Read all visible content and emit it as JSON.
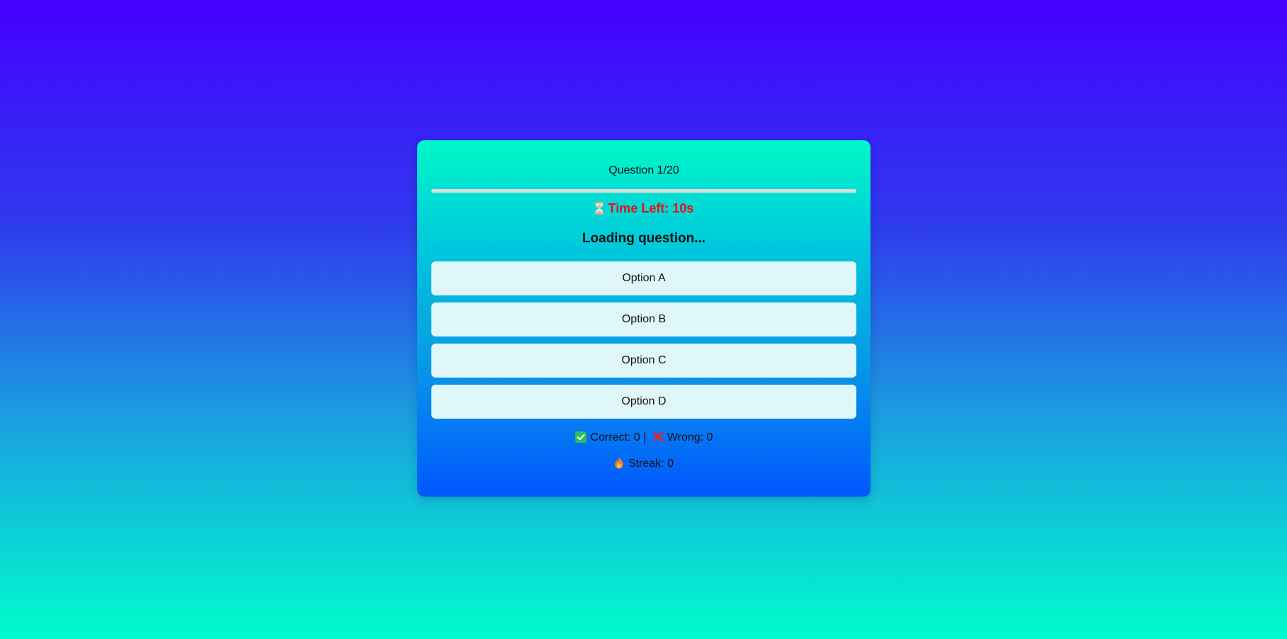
{
  "quiz": {
    "question_counter": "Question 1/20",
    "progress_fraction": 0,
    "timer_text": "Time Left: 10s",
    "question_text": "Loading question...",
    "options": [
      {
        "label": "Option A"
      },
      {
        "label": "Option B"
      },
      {
        "label": "Option C"
      },
      {
        "label": "Option D"
      }
    ],
    "score": {
      "correct_text": "Correct: 0 |",
      "wrong_text": "Wrong: 0"
    },
    "streak_text": "Streak: 0"
  },
  "icons": {
    "timer": "hourglass-icon",
    "correct": "check-icon",
    "wrong": "cross-icon",
    "streak": "fire-icon"
  },
  "colors": {
    "timer_text": "#e3101a",
    "option_bg": "#e0f7fa",
    "correct_icon": "#2fbd5a",
    "wrong_icon": "#e8202e",
    "streak_icon": "#f57c1f"
  }
}
